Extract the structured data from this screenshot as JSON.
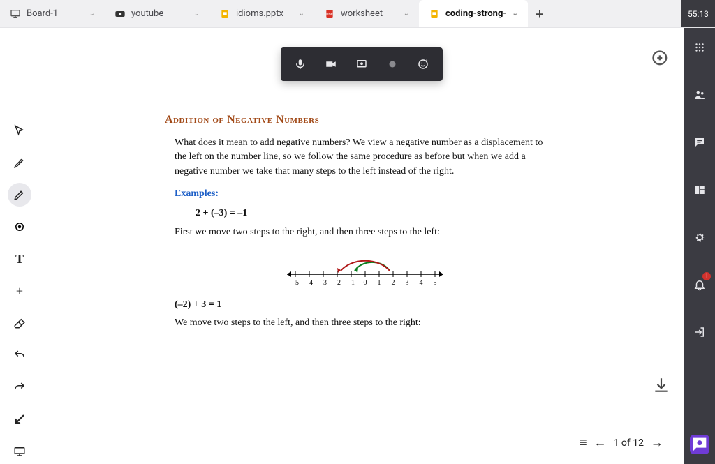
{
  "timer": "55:13",
  "tabs": [
    {
      "label": "Board-1",
      "kind": "board"
    },
    {
      "label": "youtube",
      "kind": "youtube"
    },
    {
      "label": "idioms.pptx",
      "kind": "slides"
    },
    {
      "label": "worksheet",
      "kind": "pdf"
    },
    {
      "label": "coding-strong-",
      "kind": "slides",
      "active": true
    }
  ],
  "doc": {
    "title": "Addition of Negative Numbers",
    "intro": "What does it mean to add negative numbers? We view a negative number as a displacement to the left on the number line, so we follow the same procedure as before but when we add a negative number we take that many steps to the left instead of the right.",
    "examples_label": "Examples:",
    "eq1": "2 + (–3) = –1",
    "step1": "First we move two steps to the right, and then three steps to the left:",
    "numberline_ticks": [
      "–5",
      "–4",
      "–3",
      "–2",
      "–1",
      "0",
      "1",
      "2",
      "3",
      "4",
      "5"
    ],
    "eq2": "(–2) + 3 = 1",
    "step2": "We move two steps to the left, and then three steps to the right:"
  },
  "pager": {
    "current": 1,
    "total": 12,
    "text": "1 of 12"
  },
  "notifications_count": "1"
}
